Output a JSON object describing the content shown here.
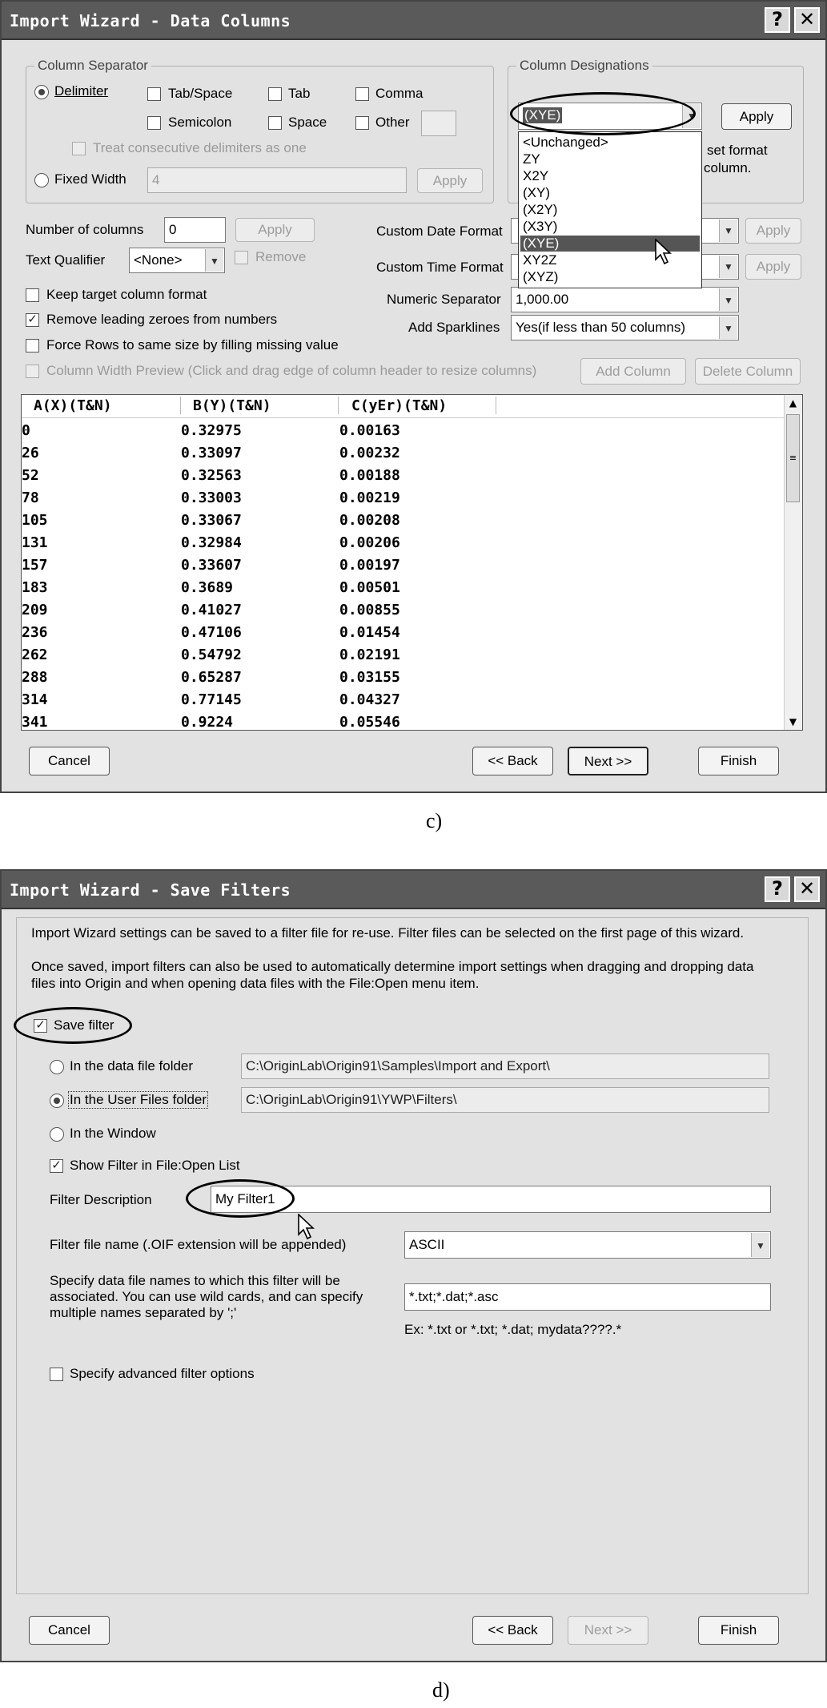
{
  "panel_c": {
    "title": "Import Wizard - Data Columns",
    "help_glyph": "?",
    "close_glyph": "✕",
    "column_separator": {
      "group_title": "Column Separator",
      "delimiter_label": "Delimiter",
      "tab_space_label": "Tab/Space",
      "tab_label": "Tab",
      "comma_label": "Comma",
      "semicolon_label": "Semicolon",
      "space_label": "Space",
      "other_label": "Other",
      "treat_consecutive_label": "Treat consecutive delimiters as one",
      "fixed_width_label": "Fixed Width",
      "fixed_width_value": "4",
      "apply_label": "Apply"
    },
    "column_designations": {
      "group_title": "Column Designations",
      "selected_value": "(XYE)",
      "apply_label": "Apply",
      "hint_text_1": "set format",
      "hint_text_2": "column.",
      "options": [
        "<Unchanged>",
        "ZY",
        "X2Y",
        "(XY)",
        "(X2Y)",
        "(X3Y)",
        "(XYE)",
        "XY2Z",
        "(XYZ)"
      ],
      "highlighted_option": "(XYE)"
    },
    "number_of_columns_label": "Number of columns",
    "number_of_columns_value": "0",
    "number_apply_label": "Apply",
    "text_qualifier_label": "Text Qualifier",
    "text_qualifier_value": "<None>",
    "remove_label": "Remove",
    "custom_date_format_label": "Custom Date Format",
    "custom_time_format_label": "Custom Time Format",
    "date_apply_label": "Apply",
    "time_apply_label": "Apply",
    "numeric_separator_label": "Numeric Separator",
    "numeric_separator_value": "1,000.00",
    "add_sparklines_label": "Add Sparklines",
    "add_sparklines_value": "Yes(if less than 50 columns)",
    "keep_target_label": "Keep target column format",
    "remove_leading_zeroes_label": "Remove leading zeroes from numbers",
    "force_rows_label": "Force Rows to same size by filling missing value",
    "column_width_preview_label": "Column Width Preview (Click and drag edge of column header to resize columns)",
    "add_column_label": "Add Column",
    "delete_column_label": "Delete Column",
    "table": {
      "headers": [
        "A(X)(T&N)",
        "B(Y)(T&N)",
        "C(yEr)(T&N)"
      ],
      "rows": [
        [
          "0",
          "0.32975",
          "0.00163"
        ],
        [
          "26",
          "0.33097",
          "0.00232"
        ],
        [
          "52",
          "0.32563",
          "0.00188"
        ],
        [
          "78",
          "0.33003",
          "0.00219"
        ],
        [
          "105",
          "0.33067",
          "0.00208"
        ],
        [
          "131",
          "0.32984",
          "0.00206"
        ],
        [
          "157",
          "0.33607",
          "0.00197"
        ],
        [
          "183",
          "0.3689",
          "0.00501"
        ],
        [
          "209",
          "0.41027",
          "0.00855"
        ],
        [
          "236",
          "0.47106",
          "0.01454"
        ],
        [
          "262",
          "0.54792",
          "0.02191"
        ],
        [
          "288",
          "0.65287",
          "0.03155"
        ],
        [
          "314",
          "0.77145",
          "0.04327"
        ],
        [
          "341",
          "0.9224",
          "0.05546"
        ]
      ]
    },
    "cancel_label": "Cancel",
    "back_label": "<< Back",
    "next_label": "Next >>",
    "finish_label": "Finish",
    "caption": "c)"
  },
  "panel_d": {
    "title": "Import Wizard - Save Filters",
    "help_glyph": "?",
    "close_glyph": "✕",
    "intro_text": "Import Wizard settings can be saved to a filter file for re-use. Filter files can be selected on the first page of this wizard.",
    "info_text_1": "Once saved, import filters can also be used to automatically determine import settings when dragging and dropping data",
    "info_text_2": "files into Origin and when opening data files with the File:Open menu item.",
    "save_filter_label": "Save filter",
    "data_file_folder_label": "In the data file folder",
    "data_file_folder_path": "C:\\OriginLab\\Origin91\\Samples\\Import and Export\\",
    "user_files_folder_label": "In the User Files folder",
    "user_files_folder_path": "C:\\OriginLab\\Origin91\\YWP\\Filters\\",
    "in_window_label": "In the Window",
    "show_filter_label": "Show Filter in File:Open List",
    "filter_description_label": "Filter Description",
    "filter_description_value": "My Filter1",
    "filter_file_name_label": "Filter file name (.OIF extension will be appended)",
    "filter_file_name_value": "ASCII",
    "specify_names_text_1": "Specify data file names to which this filter will be",
    "specify_names_text_2": "associated.  You can use wild cards, and can specify",
    "specify_names_text_3": "multiple names separated by ';'",
    "file_names_value": "*.txt;*.dat;*.asc",
    "example_text": "Ex: *.txt or *.txt; *.dat; mydata????.*",
    "advanced_options_label": "Specify advanced filter options",
    "cancel_label": "Cancel",
    "back_label": "<< Back",
    "next_label": "Next >>",
    "finish_label": "Finish",
    "caption": "d)"
  },
  "glyphs": {
    "check": "✓",
    "dropdown": "▼",
    "scroll_up": "▲",
    "scroll_down": "▼",
    "scroll_grip": "≡"
  }
}
